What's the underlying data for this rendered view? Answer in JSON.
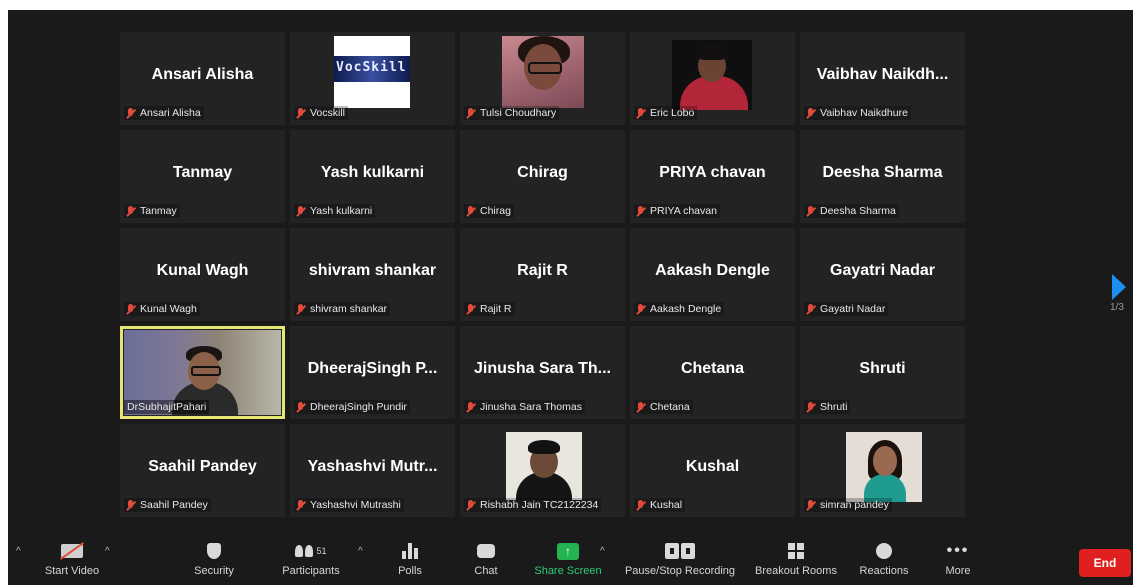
{
  "participants": [
    {
      "display": "Ansari Alisha",
      "label": "Ansari Alisha"
    },
    {
      "display": "",
      "label": "Vocskill",
      "video": "vocskill-logo"
    },
    {
      "display": "",
      "label": "Tulsi Choudhary",
      "video": "tulsi"
    },
    {
      "display": "",
      "label": "Eric Lobo",
      "video": "eric"
    },
    {
      "display": "Vaibhav  Naikdh...",
      "label": "Vaibhav Naikdhure"
    },
    {
      "display": "Tanmay",
      "label": "Tanmay"
    },
    {
      "display": "Yash kulkarni",
      "label": "Yash kulkarni"
    },
    {
      "display": "Chirag",
      "label": "Chirag"
    },
    {
      "display": "PRIYA chavan",
      "label": "PRIYA chavan"
    },
    {
      "display": "Deesha Sharma",
      "label": "Deesha Sharma"
    },
    {
      "display": "Kunal Wagh",
      "label": "Kunal Wagh"
    },
    {
      "display": "shivram shankar",
      "label": "shivram shankar"
    },
    {
      "display": "Rajit R",
      "label": "Rajit R"
    },
    {
      "display": "Aakash Dengle",
      "label": "Aakash Dengle"
    },
    {
      "display": "Gayatri Nadar",
      "label": "Gayatri Nadar"
    },
    {
      "display": "",
      "label": "DrSubhajitPahari",
      "video": "subha"
    },
    {
      "display": "DheerajSingh  P...",
      "label": "DheerajSingh Pundir"
    },
    {
      "display": "Jinusha  Sara  Th...",
      "label": "Jinusha Sara Thomas"
    },
    {
      "display": "Chetana",
      "label": "Chetana"
    },
    {
      "display": "Shruti",
      "label": "Shruti"
    },
    {
      "display": "Saahil Pandey",
      "label": "Saahil Pandey"
    },
    {
      "display": "Yashashvi  Mutr...",
      "label": "Yashashvi Mutrashi"
    },
    {
      "display": "",
      "label": "Rishabh Jain TC2122234",
      "video": "rishabh"
    },
    {
      "display": "Kushal",
      "label": "Kushal"
    },
    {
      "display": "",
      "label": "simran pandey",
      "video": "simran"
    }
  ],
  "vocskill_logo_text": "VocSkill",
  "pagination": {
    "page": "1/3"
  },
  "toolbar": {
    "start_video": "Start Video",
    "security": "Security",
    "participants": "Participants",
    "participants_count": "51",
    "polls": "Polls",
    "chat": "Chat",
    "share_screen": "Share Screen",
    "recording": "Pause/Stop Recording",
    "breakout": "Breakout Rooms",
    "reactions": "Reactions",
    "more": "More",
    "end": "End"
  },
  "colors": {
    "background": "#1a1a1a",
    "tile": "#232323",
    "active_speaker": "#e5e574",
    "end_button": "#e0201f",
    "share_green": "#23b451",
    "next_arrow": "#1f8ef1"
  }
}
